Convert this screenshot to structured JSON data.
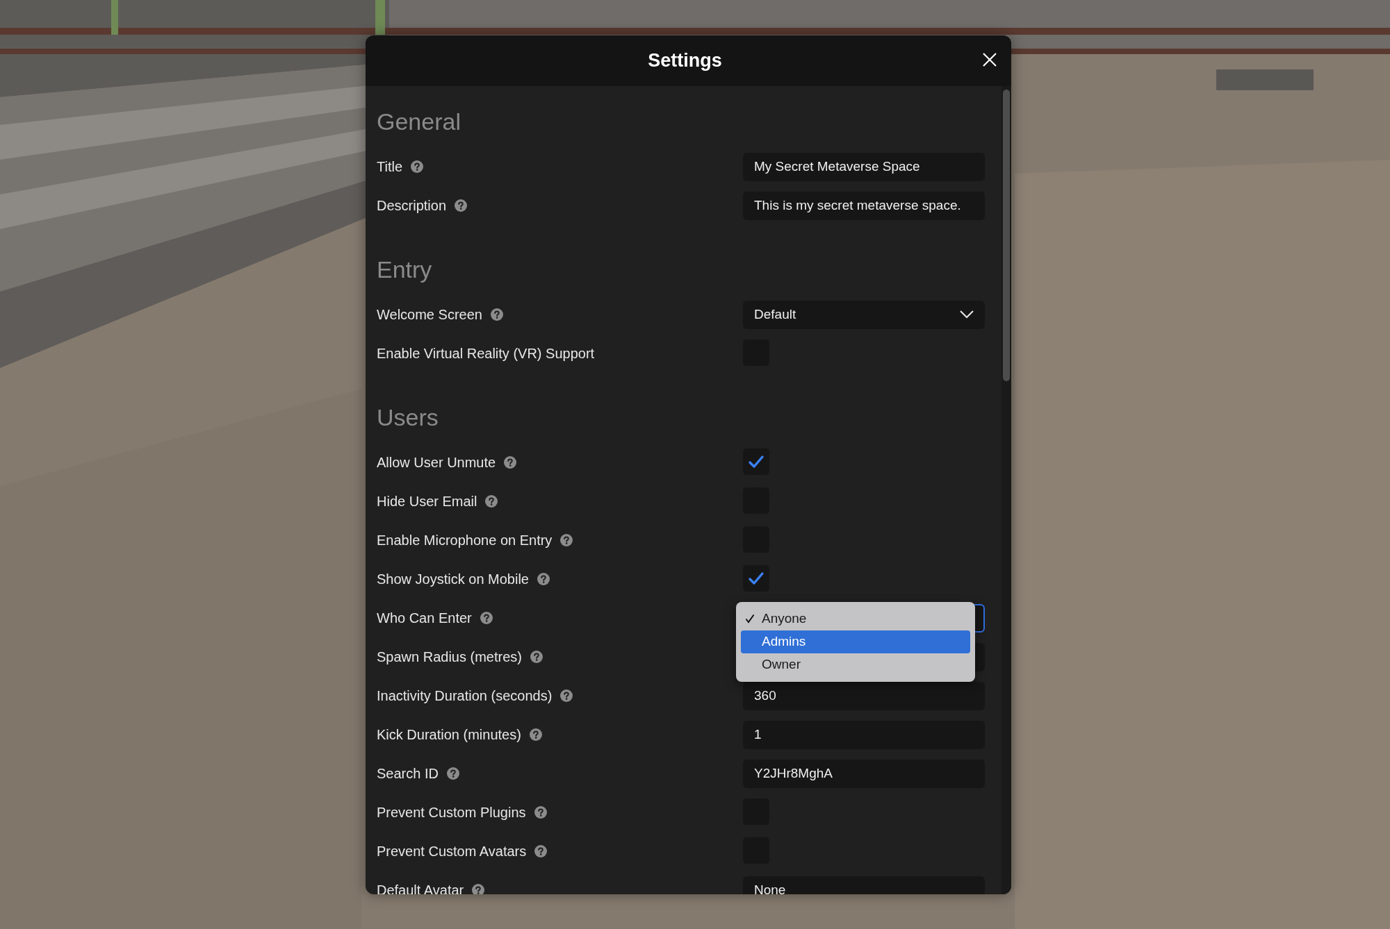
{
  "window": {
    "title": "Settings"
  },
  "sections": [
    {
      "heading": "General",
      "rows": [
        {
          "kind": "text",
          "label": "Title",
          "help": true,
          "value": "My Secret Metaverse Space"
        },
        {
          "kind": "text",
          "label": "Description",
          "help": true,
          "value": "This is my secret metaverse space."
        }
      ]
    },
    {
      "heading": "Entry",
      "rows": [
        {
          "kind": "select",
          "label": "Welcome Screen",
          "help": true,
          "value": "Default",
          "open": false
        },
        {
          "kind": "checkbox",
          "label": "Enable Virtual Reality (VR) Support",
          "help": false,
          "checked": false
        }
      ]
    },
    {
      "heading": "Users",
      "rows": [
        {
          "kind": "checkbox",
          "label": "Allow User Unmute",
          "help": true,
          "checked": true
        },
        {
          "kind": "checkbox",
          "label": "Hide User Email",
          "help": true,
          "checked": false
        },
        {
          "kind": "checkbox",
          "label": "Enable Microphone on Entry",
          "help": true,
          "checked": false
        },
        {
          "kind": "checkbox",
          "label": "Show Joystick on Mobile",
          "help": true,
          "checked": true
        },
        {
          "kind": "select",
          "label": "Who Can Enter",
          "help": true,
          "open": true,
          "options": [
            {
              "label": "Anyone",
              "checked": true,
              "highlighted": false
            },
            {
              "label": "Admins",
              "checked": false,
              "highlighted": true
            },
            {
              "label": "Owner",
              "checked": false,
              "highlighted": false
            }
          ]
        },
        {
          "kind": "text",
          "label": "Spawn Radius (metres)",
          "help": true
        },
        {
          "kind": "text",
          "label": "Inactivity Duration (seconds)",
          "help": true,
          "value": "360"
        },
        {
          "kind": "text",
          "label": "Kick Duration (minutes)",
          "help": true,
          "value": "1"
        },
        {
          "kind": "text",
          "label": "Search ID",
          "help": true,
          "value": "Y2JHr8MghA"
        },
        {
          "kind": "checkbox",
          "label": "Prevent Custom Plugins",
          "help": true,
          "checked": false
        },
        {
          "kind": "checkbox",
          "label": "Prevent Custom Avatars",
          "help": true,
          "checked": false
        },
        {
          "kind": "text",
          "label": "Default Avatar",
          "help": true,
          "value": "None"
        }
      ]
    }
  ]
}
